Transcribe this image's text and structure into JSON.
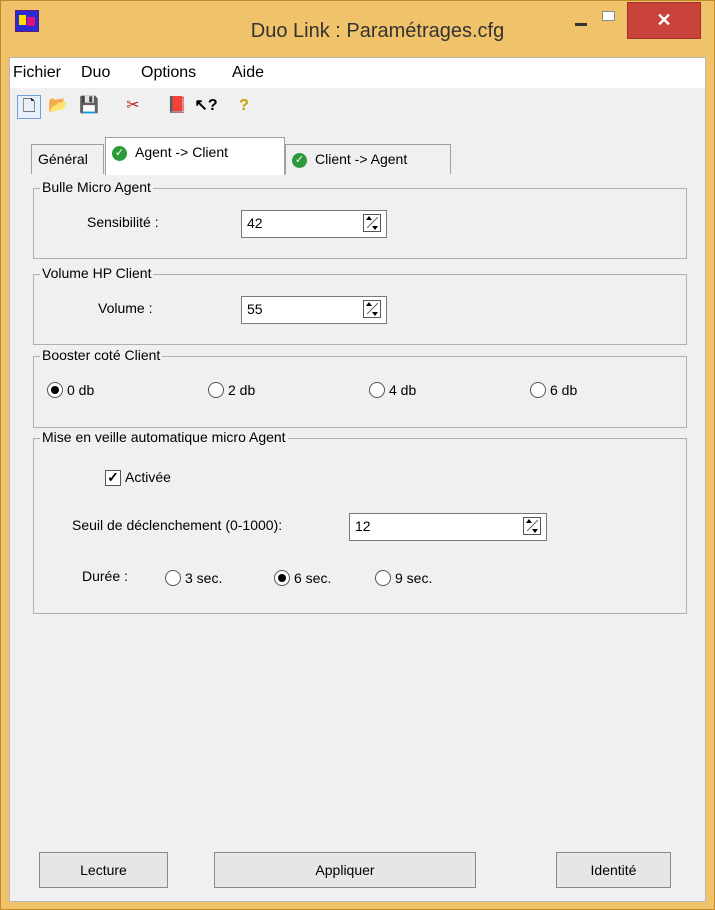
{
  "window": {
    "title": "Duo Link : Paramétrages.cfg",
    "close_glyph": "✕"
  },
  "menu": [
    "Fichier",
    "Duo",
    "Options",
    "Aide"
  ],
  "toolbar": [
    {
      "name": "new-file-icon",
      "glyph": "🗋"
    },
    {
      "name": "open-folder-icon",
      "glyph": "📂"
    },
    {
      "name": "save-icon",
      "glyph": "💾"
    },
    {
      "name": "connect-icon",
      "glyph": "✂"
    },
    {
      "name": "book-icon",
      "glyph": "📕"
    },
    {
      "name": "context-help-icon",
      "glyph": "↖?"
    },
    {
      "name": "help-icon",
      "glyph": "?"
    }
  ],
  "tabs": [
    {
      "label": "Général",
      "selected": false,
      "has_check": false
    },
    {
      "label": "Agent -> Client",
      "selected": true,
      "has_check": true
    },
    {
      "label": "Client -> Agent",
      "selected": false,
      "has_check": true
    }
  ],
  "bulle": {
    "title": "Bulle Micro Agent",
    "label": "Sensibilité :",
    "value": "42"
  },
  "volume": {
    "title": "Volume HP Client",
    "label": "Volume :",
    "value": "55"
  },
  "booster": {
    "title": "Booster coté Client",
    "options": [
      "0 db",
      "2 db",
      "4 db",
      "6 db"
    ],
    "selected": "0 db"
  },
  "veille": {
    "title": "Mise en veille automatique micro Agent",
    "checkbox_label": "Activée",
    "checked": true,
    "seuil_label": "Seuil de déclenchement (0-1000):",
    "seuil_value": "12",
    "duree_label": "Durée :",
    "duree_options": [
      "3 sec.",
      "6 sec.",
      "9 sec."
    ],
    "duree_selected": "6 sec."
  },
  "buttons": {
    "lecture": "Lecture",
    "appliquer": "Appliquer",
    "identite": "Identité"
  },
  "colors": {
    "titlebar": "#f0c36a",
    "close": "#c9433b",
    "panel": "#f0f0f0",
    "check": "#2c9a3a"
  }
}
